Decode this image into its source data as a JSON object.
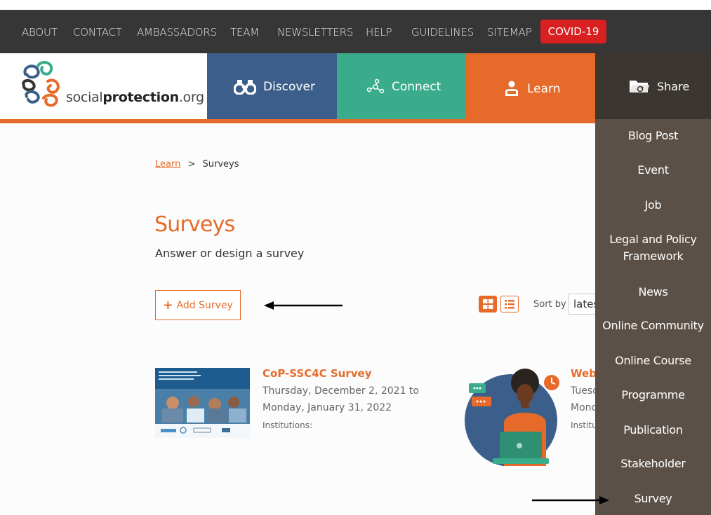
{
  "colors": {
    "accent": "#e66b2a",
    "nav_dark": "#363636",
    "covid": "#d92020",
    "discover": "#3b5f8a",
    "connect": "#3aab8b",
    "learn": "#e66b2a",
    "share_panel": "#5b5048",
    "share_head": "#3b3630"
  },
  "topnav": {
    "links": [
      "ABOUT",
      "CONTACT",
      "AMBASSADORS",
      "TEAM",
      "NEWSLETTERS",
      "HELP",
      "GUIDELINES",
      "SITEMAP"
    ],
    "covid_label": "COVID-19"
  },
  "brand": {
    "logo_prefix": "social",
    "logo_bold": "protection",
    "logo_suffix": ".org"
  },
  "mainnav": {
    "discover": "Discover",
    "connect": "Connect",
    "learn": "Learn",
    "share": "Share"
  },
  "share_menu": {
    "items": [
      "Blog Post",
      "Event",
      "Job",
      "Legal and Policy Framework",
      "News",
      "Online Community",
      "Online Course",
      "Programme",
      "Publication",
      "Stakeholder",
      "Survey"
    ]
  },
  "breadcrumb": {
    "parent": "Learn",
    "separator": ">",
    "current": "Surveys"
  },
  "page": {
    "title": "Surveys",
    "subtitle": "Answer or design a survey"
  },
  "toolbar": {
    "add_label": "Add Survey",
    "add_icon": "+",
    "sort_label": "Sort by",
    "sort_value": "latest"
  },
  "cards": [
    {
      "title": "CoP-SSC4C Survey",
      "date_start": "Thursday, December 2, 2021 to",
      "date_end": "Monday, January 31, 2022",
      "institutions_label": "Institutions:"
    },
    {
      "title": "Webinar Survey",
      "date_start": "Tuesday",
      "date_end": "Monday",
      "institutions_label": "Institutions:"
    }
  ]
}
